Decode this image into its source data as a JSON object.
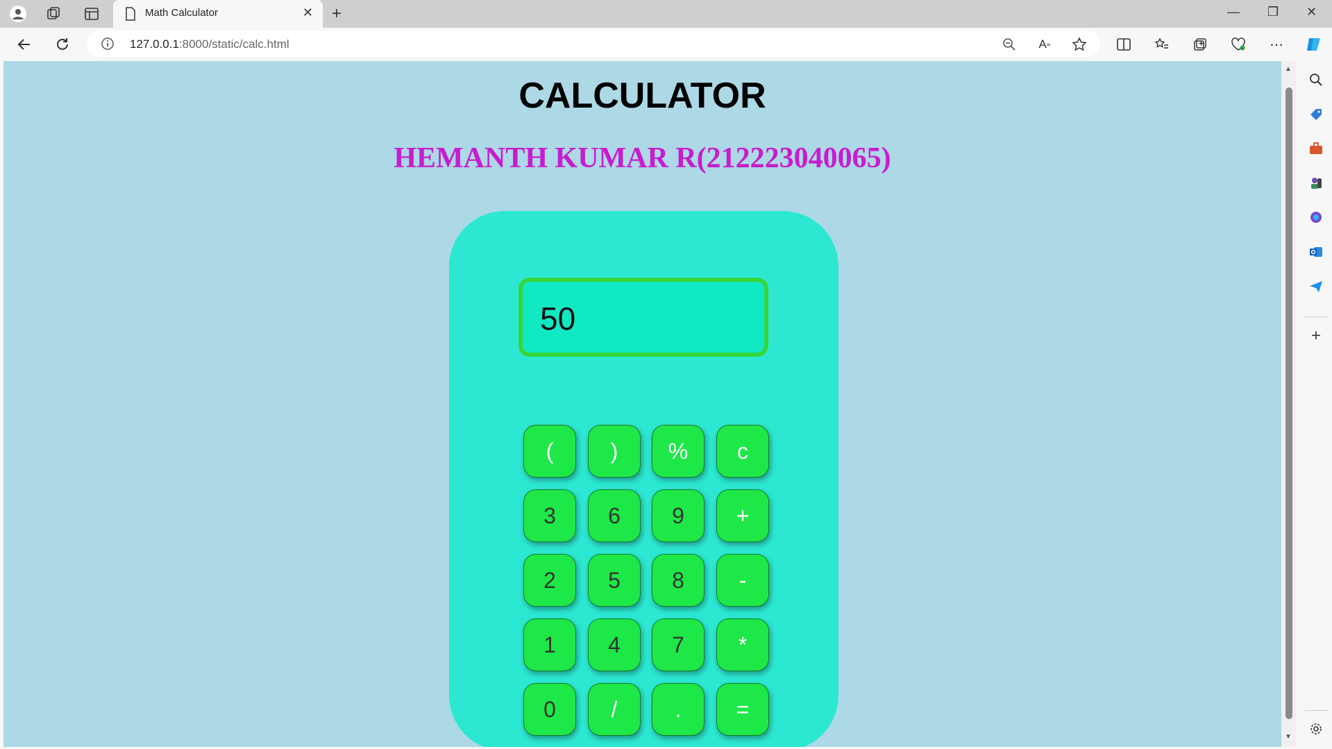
{
  "browser": {
    "tab_title": "Math Calculator",
    "url_host": "127.0.0.1",
    "url_rest": ":8000/static/calc.html"
  },
  "page": {
    "title": "CALCULATOR",
    "subtitle": "HEMANTH KUMAR R(212223040065)"
  },
  "calculator": {
    "display_value": "50",
    "buttons": [
      [
        "(",
        ")",
        "%",
        "c"
      ],
      [
        "3",
        "6",
        "9",
        "+"
      ],
      [
        "2",
        "5",
        "8",
        "-"
      ],
      [
        "1",
        "4",
        "7",
        "*"
      ],
      [
        "0",
        "/",
        ".",
        "="
      ]
    ]
  },
  "colors": {
    "page_bg": "#add8e6",
    "calc_bg": "#2ce8d2",
    "display_bg": "#10e9c2",
    "display_border": "#36d63a",
    "button_bg": "#1ee847",
    "subtitle": "#c71ccf"
  }
}
